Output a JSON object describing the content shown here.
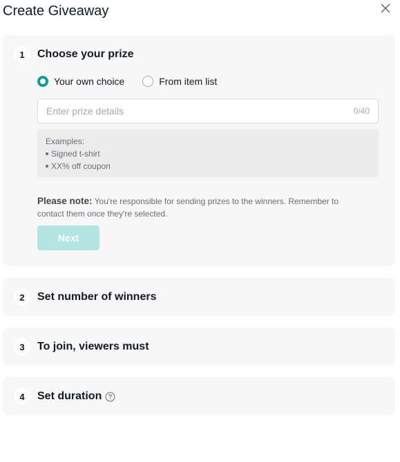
{
  "dialog": {
    "title": "Create Giveaway",
    "close_icon": "close-icon"
  },
  "steps": [
    {
      "number": "1",
      "title": "Choose your prize",
      "options": [
        {
          "label": "Your own choice",
          "checked": true
        },
        {
          "label": "From item list",
          "checked": false
        }
      ],
      "input": {
        "value": "",
        "placeholder": "Enter prize details",
        "counter": "0/40"
      },
      "examples": {
        "heading": "Examples:",
        "items": [
          "Signed t-shirt",
          "XX% off coupon"
        ]
      },
      "note": {
        "label": "Please note:",
        "text": " You're responsible for sending prizes to the winners. Remember to contact them once they're selected."
      },
      "next_label": "Next"
    },
    {
      "number": "2",
      "title": "Set number of winners"
    },
    {
      "number": "3",
      "title": "To join, viewers must"
    },
    {
      "number": "4",
      "title": "Set duration",
      "icon": "help-icon"
    }
  ],
  "colors": {
    "accent": "#0f9d94",
    "button_disabled": "#b3e6e3",
    "panel_bg": "#f7f7f7"
  }
}
